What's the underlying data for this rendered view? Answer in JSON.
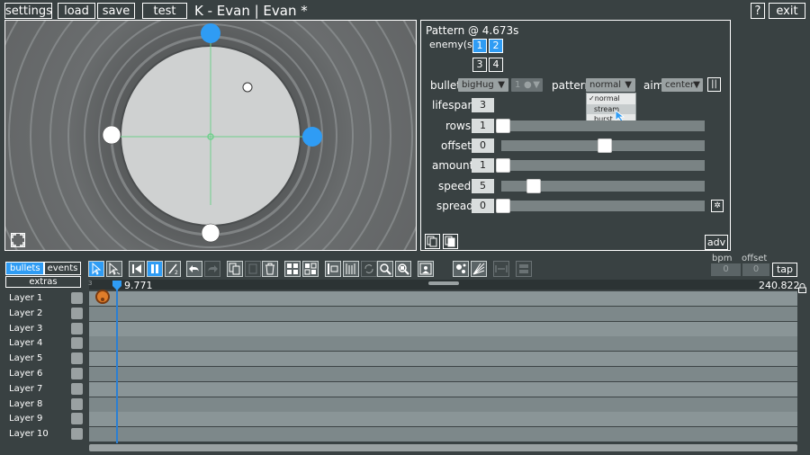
{
  "topbar": {
    "settings": "settings",
    "load": "load",
    "save": "save",
    "test": "test",
    "title": "K - Evan | Evan *",
    "help": "?",
    "exit": "exit"
  },
  "pattern_panel": {
    "header": "Pattern @ 4.673s",
    "enemy_label": "enemy(s)",
    "enemies": [
      "1",
      "2",
      "3",
      "4"
    ],
    "bullet_label": "bullet",
    "bullet_value": "bigHug",
    "bullet_sub_value": "1",
    "pattern_label": "pattern",
    "pattern_value": "normal",
    "pattern_options": [
      "normal",
      "stream",
      "burst"
    ],
    "selected_option": "normal",
    "aim_label": "aim",
    "aim_value": "center",
    "aim_lock": "||",
    "lifespan_label": "lifespan",
    "lifespan_value": "3",
    "rows_label": "rows",
    "rows_value": "1",
    "offset_label": "offset",
    "offset_value": "0",
    "amount_label": "amount",
    "amount_value": "1",
    "speed_label": "speed",
    "speed_value": "5",
    "spread_label": "spread",
    "spread_value": "0",
    "adv": "adv",
    "slider_levels": {
      "rows": 0.0,
      "offset": 0.5,
      "amount": 0.0,
      "speed": 0.15,
      "spread": 0.0
    }
  },
  "tabs": {
    "bullets": "bullets",
    "events": "events",
    "extras": "extras"
  },
  "tempo": {
    "bpm_label": "bpm",
    "bpm_value": "0",
    "offset_label": "offset",
    "offset_value": "0",
    "tap": "tap"
  },
  "timeline": {
    "current_time": "9.771",
    "end_time": "240.822",
    "layers": [
      "Layer 1",
      "Layer 2",
      "Layer 3",
      "Layer 4",
      "Layer 5",
      "Layer 6",
      "Layer 7",
      "Layer 8",
      "Layer 9",
      "Layer 10"
    ]
  },
  "colors": {
    "background": "#394142",
    "accent_blue": "#2f9cf4",
    "panel_border": "#ffffff",
    "timeline_lane": "#8a9597",
    "playhead": "#2b7fd3"
  }
}
